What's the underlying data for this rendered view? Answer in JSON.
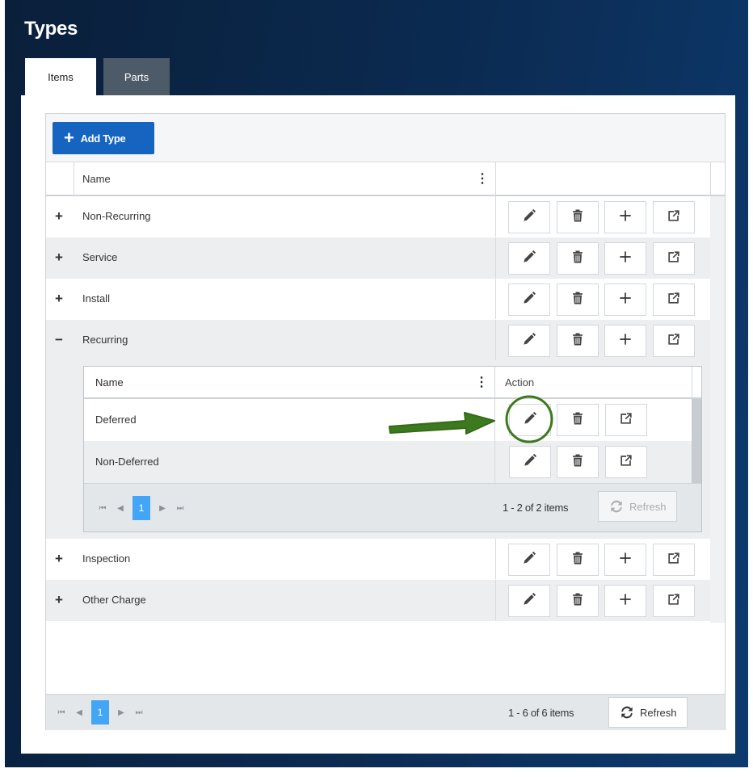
{
  "title": "Types",
  "tabs": [
    {
      "label": "Items",
      "active": true
    },
    {
      "label": "Parts",
      "active": false
    }
  ],
  "toolbar": {
    "add_label": "Add Type"
  },
  "grid": {
    "column_name": "Name",
    "rows": [
      {
        "label": "Non-Recurring",
        "toggle": "+"
      },
      {
        "label": "Service",
        "toggle": "+"
      },
      {
        "label": "Install",
        "toggle": "+"
      },
      {
        "label": "Recurring",
        "toggle": "−"
      },
      {
        "label": "Inspection",
        "toggle": "+"
      },
      {
        "label": "Other Charge",
        "toggle": "+"
      }
    ],
    "detail": {
      "column_name": "Name",
      "column_action": "Action",
      "rows": [
        {
          "label": "Deferred"
        },
        {
          "label": "Non-Deferred"
        }
      ],
      "pager": {
        "page": "1",
        "info": "1 - 2 of 2 items",
        "refresh": "Refresh"
      }
    },
    "pager": {
      "page": "1",
      "info": "1 - 6 of 6 items",
      "refresh": "Refresh"
    }
  },
  "icons": {
    "edit": "pencil-icon",
    "delete": "trash-icon",
    "add": "plus-icon",
    "open": "external-link-icon",
    "refresh": "refresh-icon"
  },
  "colors": {
    "header_bg": "#0b2b52",
    "primary": "#1565c0",
    "page_active": "#42a5f5",
    "annotation": "#3d7a1f"
  }
}
